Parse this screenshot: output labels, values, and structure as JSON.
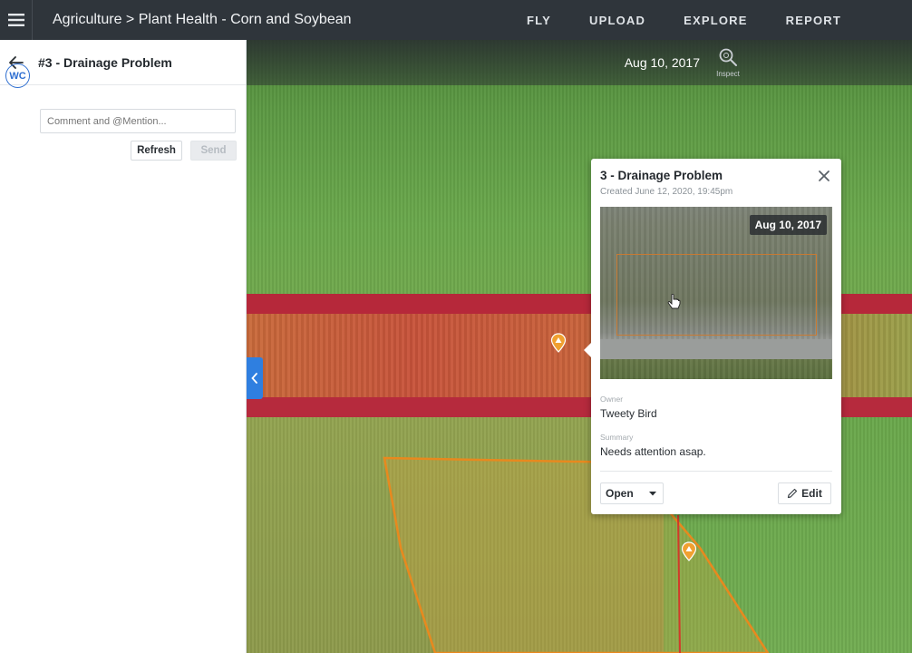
{
  "header": {
    "menu_icon": "hamburger-menu-icon",
    "title": "Agriculture > Plant Health - Corn and Soybean",
    "nav": [
      {
        "label": "FLY"
      },
      {
        "label": "UPLOAD"
      },
      {
        "label": "EXPLORE"
      },
      {
        "label": "REPORT"
      }
    ]
  },
  "left_panel": {
    "back_icon": "arrow-left-icon",
    "title": "#3 - Drainage Problem",
    "avatar_initials": "WC",
    "comment_placeholder": "Comment and @Mention...",
    "refresh_label": "Refresh",
    "send_label": "Send"
  },
  "map": {
    "date": "Aug 10, 2017",
    "inspect_label": "Inspect",
    "collapse_icon": "chevron-left-icon"
  },
  "card": {
    "title": "3 - Drainage Problem",
    "created": "Created June 12, 2020, 19:45pm",
    "image_date": "Aug 10, 2017",
    "owner_label": "Owner",
    "owner_value": "Tweety Bird",
    "summary_label": "Summary",
    "summary_value": "Needs attention asap.",
    "status_value": "Open",
    "edit_label": "Edit"
  },
  "colors": {
    "topbar": "#2f353b",
    "accent_blue": "#2f7fe0",
    "pin_orange": "#f0a030",
    "field_boundary": "#e8891e",
    "red_band": "#b6283a"
  }
}
